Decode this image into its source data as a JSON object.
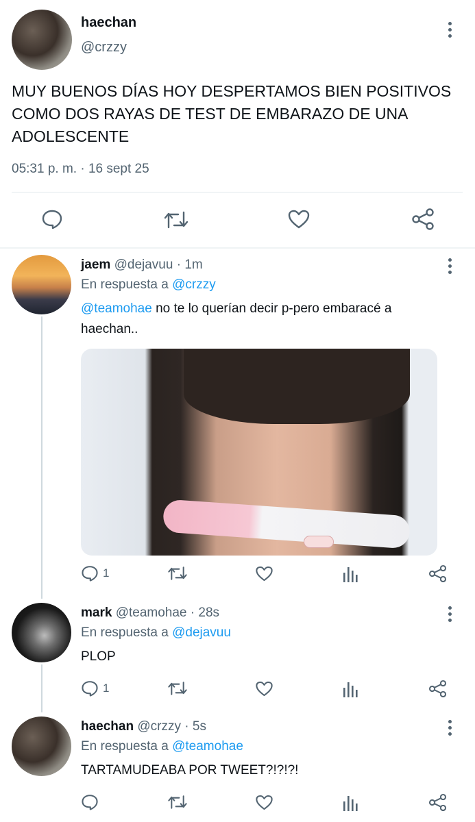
{
  "main_tweet": {
    "name": "haechan",
    "handle": "@crzzy",
    "text": "MUY BUENOS DÍAS HOY DESPERTAMOS BIEN POSITIVOS COMO DOS RAYAS DE TEST DE EMBARAZO DE UNA ADOLESCENTE",
    "timestamp": "05:31 p. m. · 16 sept 25"
  },
  "replies": [
    {
      "name": "jaem",
      "handle_time": "@dejavuu · 1m",
      "in_reply_prefix": "En respuesta a",
      "in_reply_handle": "@crzzy",
      "mention": "@teamohae",
      "text_rest": " no te lo querían decir p-pero embaracé a",
      "text_line2": "haechan..",
      "reply_count": "1"
    },
    {
      "name": "mark",
      "handle_time": "@teamohae · 28s",
      "in_reply_prefix": "En respuesta a",
      "in_reply_handle": "@dejavuu",
      "text": "PLOP",
      "reply_count": "1"
    },
    {
      "name": "haechan",
      "handle_time": "@crzzy · 5s",
      "in_reply_prefix": "En respuesta a",
      "in_reply_handle": "@teamohae",
      "text": "TARTAMUDEABA POR TWEET?!?!?!"
    }
  ],
  "icons": {
    "reply": "reply-icon",
    "retweet": "retweet-icon",
    "like": "heart-icon",
    "share": "share-icon",
    "views": "analytics-icon",
    "more": "more-vertical-icon"
  },
  "colors": {
    "link": "#1d9bf0",
    "secondary_text": "#536471",
    "divider": "#e1e8ed"
  }
}
